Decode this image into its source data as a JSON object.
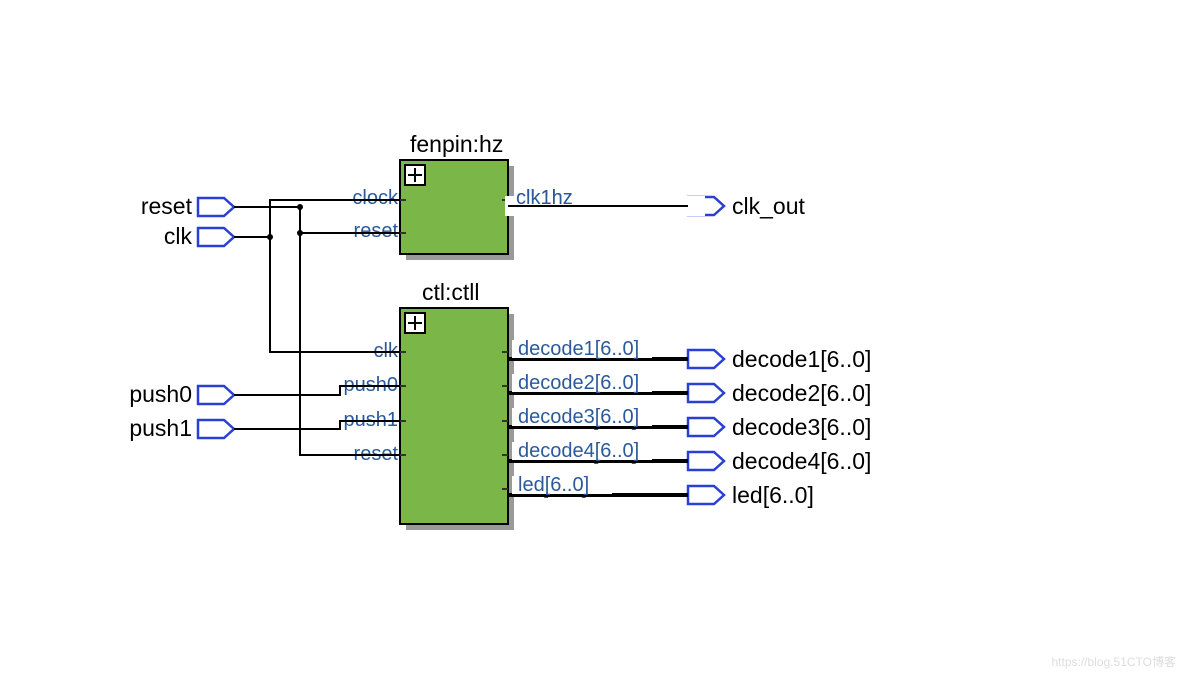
{
  "blocks": {
    "fenpin": {
      "title": "fenpin:hz",
      "inputs": [
        "clock",
        "reset"
      ],
      "outputs": [
        "clk1hz"
      ]
    },
    "ctl": {
      "title": "ctl:ctll",
      "inputs": [
        "clk",
        "push0",
        "push1",
        "reset"
      ],
      "outputs": [
        "decode1[6..0]",
        "decode2[6..0]",
        "decode3[6..0]",
        "decode4[6..0]",
        "led[6..0]"
      ]
    }
  },
  "inputs": [
    "reset",
    "clk",
    "push0",
    "push1"
  ],
  "outputs": [
    "clk_out",
    "decode1[6..0]",
    "decode2[6..0]",
    "decode3[6..0]",
    "decode4[6..0]",
    "led[6..0]"
  ],
  "watermark": "https://blog.51CTO博客"
}
